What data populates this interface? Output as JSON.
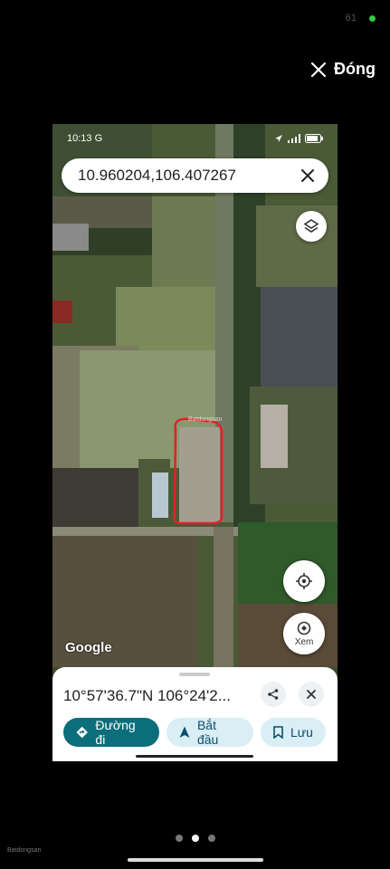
{
  "system": {
    "top_number": "61",
    "dot_color": "#2ecc40"
  },
  "close": {
    "label": "Đóng"
  },
  "phone": {
    "time": "10:13",
    "carrier_mark": "G"
  },
  "search": {
    "value": "10.960204,106.407267"
  },
  "map": {
    "attribution": "Google",
    "watermark": "Batdongsan",
    "xem_label": "Xem",
    "highlight_color": "#e0222a"
  },
  "sheet": {
    "coords": "10°57'36.7\"N 106°24'2...",
    "actions": [
      {
        "label": "Đường đi",
        "icon": "directions-icon"
      },
      {
        "label": "Bắt đầu",
        "icon": "navigation-arrow-icon"
      },
      {
        "label": "Lưu",
        "icon": "bookmark-icon"
      }
    ]
  },
  "gallery": {
    "page_count": 3,
    "active_page": 2
  },
  "brand": {
    "text": "Batdongsan"
  }
}
